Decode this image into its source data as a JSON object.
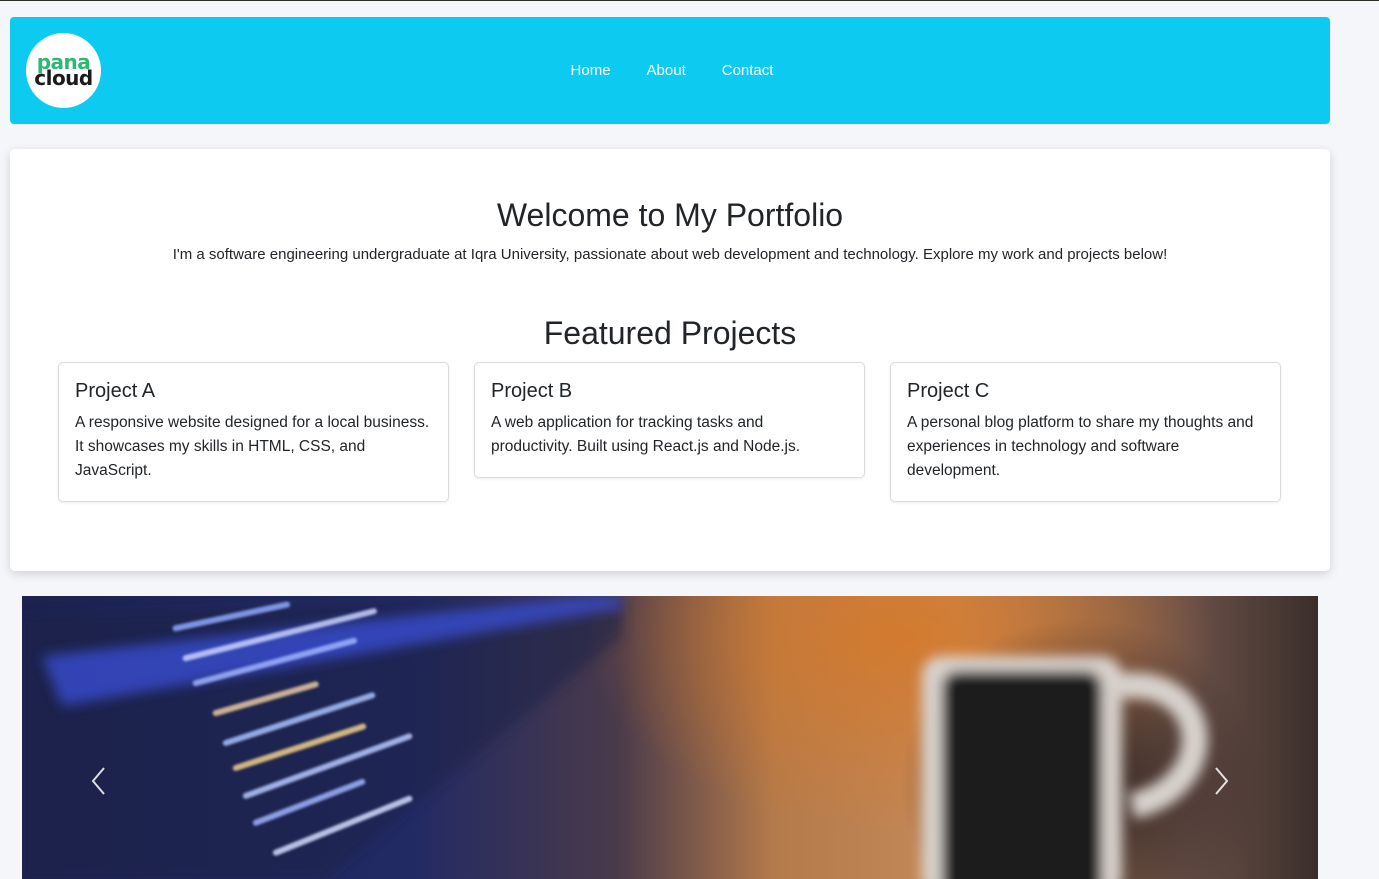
{
  "navbar": {
    "logo": {
      "line1": "pana",
      "line2": "cloud"
    },
    "links": [
      "Home",
      "About",
      "Contact"
    ]
  },
  "hero": {
    "title": "Welcome to My Portfolio",
    "text": "I'm a software engineering undergraduate at Iqra University, passionate about web development and technology. Explore my work and projects below!"
  },
  "featured": {
    "title": "Featured Projects",
    "projects": [
      {
        "title": "Project A",
        "description": "A responsive website designed for a local business. It showcases my skills in HTML, CSS, and JavaScript."
      },
      {
        "title": "Project B",
        "description": "A web application for tracking tasks and productivity. Built using React.js and Node.js."
      },
      {
        "title": "Project C",
        "description": "A personal blog platform to share my thoughts and experiences in technology and software development."
      }
    ]
  },
  "carousel": {
    "image": "laptop-code-and-coffee-mug-photo",
    "prev_icon": "chevron-left-icon",
    "next_icon": "chevron-right-icon"
  },
  "colors": {
    "navbar": "#0dcaf0",
    "logo_green": "#2eb872",
    "page_background": "#f4f6f9"
  }
}
